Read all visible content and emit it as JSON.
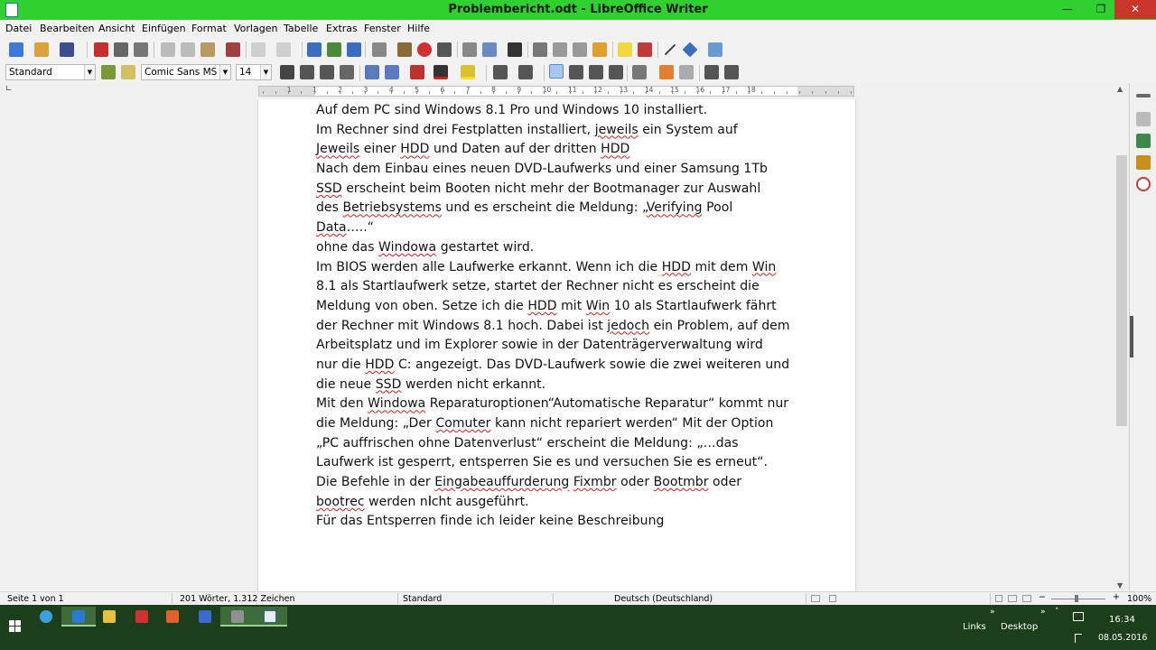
{
  "window": {
    "title": "Problembericht.odt - LibreOffice Writer",
    "minimize_glyph": "—",
    "maximize_glyph": "❐",
    "close_glyph": "✕"
  },
  "menu": [
    "Datei",
    "Bearbeiten",
    "Ansicht",
    "Einfügen",
    "Format",
    "Vorlagen",
    "Tabelle",
    "Extras",
    "Fenster",
    "Hilfe"
  ],
  "formatting": {
    "paragraph_style": "Standard",
    "font_name": "Comic Sans MS",
    "font_size": "14"
  },
  "ruler": {
    "labels": [
      "1",
      "1",
      "2",
      "3",
      "4",
      "5",
      "6",
      "7",
      "8",
      "9",
      "10",
      "11",
      "12",
      "13",
      "14",
      "15",
      "16",
      "17",
      "18"
    ]
  },
  "document": {
    "lines": [
      [
        {
          "t": "Auf dem PC sind Windows 8.1 Pro und Windows 10 installiert."
        }
      ],
      [
        {
          "t": "Im Rechner sind drei Festplatten installiert, "
        },
        {
          "t": "jeweils",
          "err": true
        },
        {
          "t": " ein System auf"
        }
      ],
      [
        {
          "t": "Jeweils",
          "err": true
        },
        {
          "t": " einer "
        },
        {
          "t": "HDD",
          "err": true
        },
        {
          "t": " und Daten auf der dritten "
        },
        {
          "t": "HDD",
          "err": true
        }
      ],
      [
        {
          "t": "Nach dem Einbau eines neuen DVD-Laufwerks und einer Samsung 1Tb"
        }
      ],
      [
        {
          "t": "SSD",
          "err": true
        },
        {
          "t": "  erscheint beim Booten nicht mehr der Bootmanager zur Auswahl"
        }
      ],
      [
        {
          "t": "des "
        },
        {
          "t": "Betriebsystems",
          "err": true
        },
        {
          "t": " und es erscheint die Meldung: „"
        },
        {
          "t": "Verifying",
          "err": true
        },
        {
          "t": " Pool"
        }
      ],
      [
        {
          "t": "Data",
          "err": true
        },
        {
          "t": "…..“"
        }
      ],
      [
        {
          "t": "ohne das "
        },
        {
          "t": "Windowa",
          "err": true
        },
        {
          "t": " gestartet wird."
        }
      ],
      [
        {
          "t": "Im BIOS werden alle Laufwerke erkannt. Wenn ich die "
        },
        {
          "t": "HDD",
          "err": true
        },
        {
          "t": " mit dem "
        },
        {
          "t": "Win",
          "err": true
        }
      ],
      [
        {
          "t": "8.1 als Startlaufwerk setze, startet der Rechner nicht es erscheint die"
        }
      ],
      [
        {
          "t": "Meldung von oben. Setze ich die "
        },
        {
          "t": "HDD",
          "err": true
        },
        {
          "t": " mit "
        },
        {
          "t": "Win",
          "err": true
        },
        {
          "t": " 10 als Startlaufwerk fährt"
        }
      ],
      [
        {
          "t": "der Rechner mit Windows 8.1 hoch. Dabei ist "
        },
        {
          "t": "jedoch",
          "err": true
        },
        {
          "t": " ein Problem, auf dem"
        }
      ],
      [
        {
          "t": "Arbeitsplatz und im Explorer sowie in der Datenträgerverwaltung  wird"
        }
      ],
      [
        {
          "t": "nur die "
        },
        {
          "t": "HDD",
          "err": true
        },
        {
          "t": " C: angezeigt. Das DVD-Laufwerk sowie die zwei weiteren und"
        }
      ],
      [
        {
          "t": "die neue "
        },
        {
          "t": "SSD",
          "err": true
        },
        {
          "t": " werden nicht erkannt."
        }
      ],
      [
        {
          "t": "Mit den "
        },
        {
          "t": "Windowa",
          "err": true
        },
        {
          "t": " Reparaturoptionen“Automatische Reparatur“ kommt nur"
        }
      ],
      [
        {
          "t": "die Meldung: „Der "
        },
        {
          "t": "Comuter",
          "err": true
        },
        {
          "t": " kann nicht repariert werden“ Mit der Option"
        }
      ],
      [
        {
          "t": "„PC auffrischen ohne Datenverlust“ erscheint die Meldung: „…das"
        }
      ],
      [
        {
          "t": "Laufwerk ist gesperrt, entsperren Sie es und versuchen Sie es erneut“."
        }
      ],
      [
        {
          "t": "Die Befehle in der "
        },
        {
          "t": "Eingabeauffurderung",
          "err": true
        },
        {
          "t": " "
        },
        {
          "t": "Fixmbr",
          "err": true
        },
        {
          "t": " oder "
        },
        {
          "t": "Bootmbr",
          "err": true
        },
        {
          "t": " oder"
        }
      ],
      [
        {
          "t": "bootrec",
          "err": true
        },
        {
          "t": " werden nicht ausgeführt."
        }
      ],
      [
        {
          "t": "Für das Entsperren finde ich leider keine Beschreibung"
        }
      ]
    ]
  },
  "statusbar": {
    "page": "Seite 1 von 1",
    "words": "201 Wörter, 1.312 Zeichen",
    "page_style": "Standard",
    "language": "Deutsch (Deutschland)",
    "zoom_minus": "−",
    "zoom_plus": "+",
    "zoom": "100%"
  },
  "taskbar": {
    "links": "Links",
    "desktop": "Desktop",
    "chevron": "»",
    "time": "16:34",
    "date": "08.05.2016"
  },
  "colors": {
    "titlebar": "#2fd02f",
    "taskbar": "#1c3e1a",
    "spell_error": "#d02020"
  }
}
